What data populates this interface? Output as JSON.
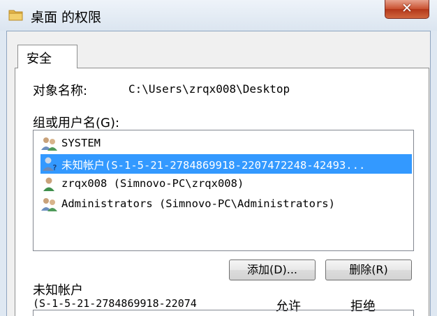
{
  "window": {
    "title": "桌面 的权限",
    "close_glyph": "✕"
  },
  "tabs": [
    {
      "label": "安全"
    }
  ],
  "object": {
    "label": "对象名称:",
    "value": "C:\\Users\\zrqx008\\Desktop"
  },
  "groups": {
    "label": "组或用户名(G):",
    "items": [
      {
        "icon": "group-users-icon",
        "text": "SYSTEM",
        "selected": false
      },
      {
        "icon": "unknown-user-icon",
        "text": "未知帐户(S-1-5-21-2784869918-2207472248-42493...",
        "selected": true
      },
      {
        "icon": "user-icon",
        "text": "zrqx008 (Simnovo-PC\\zrqx008)",
        "selected": false
      },
      {
        "icon": "group-users-icon",
        "text": "Administrators (Simnovo-PC\\Administrators)",
        "selected": false
      }
    ]
  },
  "buttons": {
    "add": "添加(D)...",
    "remove": "删除(R)"
  },
  "permissions": {
    "account_name": "未知帐户",
    "account_sid": "(S-1-5-21-2784869918-22074",
    "allow_header": "允许",
    "deny_header": "拒绝"
  },
  "colors": {
    "selection": "#3399ff",
    "close_button": "#c9502f"
  }
}
